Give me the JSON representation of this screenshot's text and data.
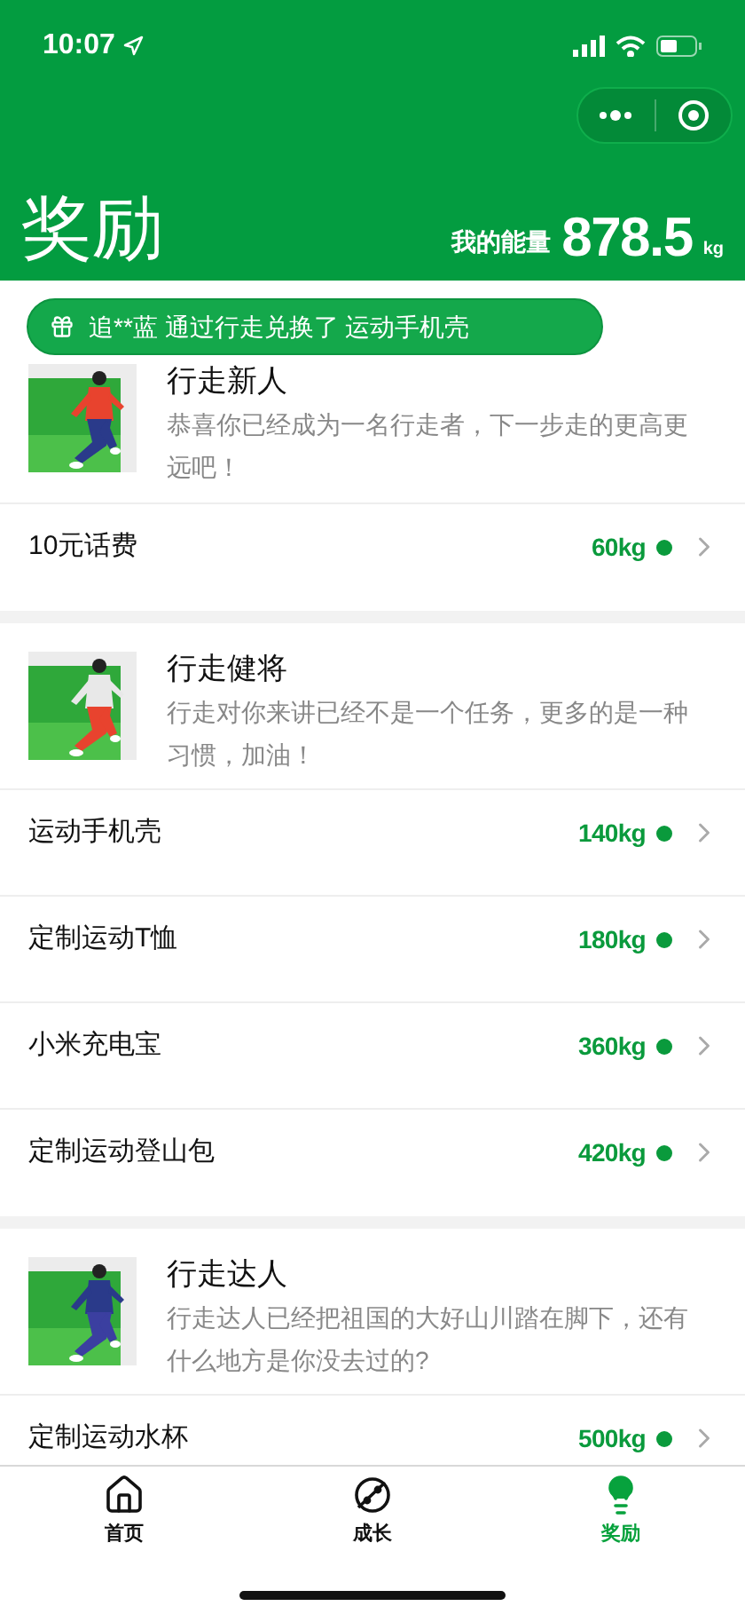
{
  "status_bar": {
    "time": "10:07"
  },
  "header": {
    "title": "奖励",
    "energy_label": "我的能量",
    "energy_value": "878.5",
    "energy_unit": "kg"
  },
  "notice": {
    "text": "追**蓝 通过行走兑换了 运动手机壳"
  },
  "levels": [
    {
      "title": "行走新人",
      "description": "恭喜你已经成为一名行走者，下一步走的更高更远吧！",
      "rewards": [
        {
          "name": "10元话费",
          "cost": "60kg"
        }
      ]
    },
    {
      "title": "行走健将",
      "description": "行走对你来讲已经不是一个任务，更多的是一种习惯，加油！",
      "rewards": [
        {
          "name": "运动手机壳",
          "cost": "140kg"
        },
        {
          "name": "定制运动T恤",
          "cost": "180kg"
        },
        {
          "name": "小米充电宝",
          "cost": "360kg"
        },
        {
          "name": "定制运动登山包",
          "cost": "420kg"
        }
      ]
    },
    {
      "title": "行走达人",
      "description": "行走达人已经把祖国的大好山川踏在脚下，还有什么地方是你没去过的?",
      "rewards": [
        {
          "name": "定制运动水杯",
          "cost": "500kg"
        }
      ]
    }
  ],
  "tab_bar": [
    {
      "kind": "home",
      "label": "首页",
      "selected": false
    },
    {
      "kind": "planet",
      "label": "成长",
      "selected": false
    },
    {
      "kind": "bulb",
      "label": "奖励",
      "selected": true
    }
  ]
}
